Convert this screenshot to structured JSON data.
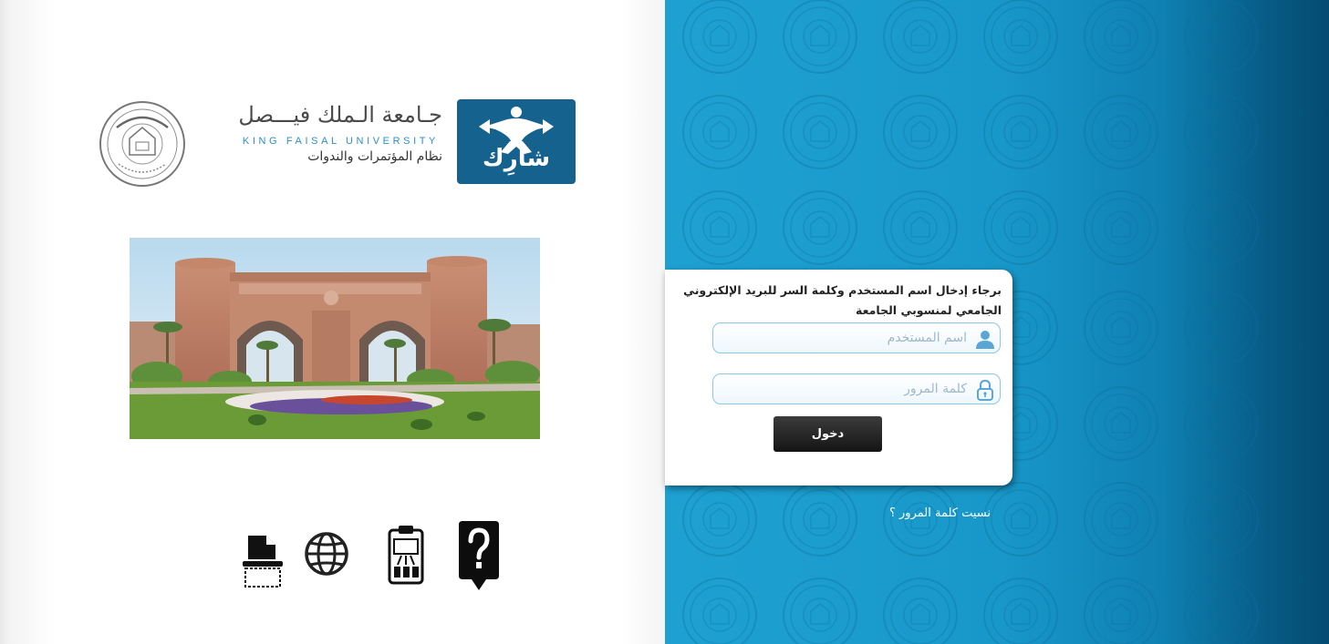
{
  "branding": {
    "share_logo_text": "شارِك",
    "university_name_ar": "جـامعة الـملك فيـــصل",
    "university_name_en": "KING FAISAL UNIVERSITY",
    "system_name": "نظام المؤتمرات والندوات"
  },
  "login": {
    "prompt": "برجاء إدخال اسم المستخدم وكلمة السر للبريد الإلكتروني الجامعي لمنسوبي الجامعة",
    "username_placeholder": "اسم المستخدم",
    "username_value": "",
    "password_placeholder": "كلمة المرور",
    "password_value": "",
    "submit_label": "دخول",
    "forgot_password_label": "نسيت كلمة المرور ؟"
  },
  "bottom_icons": [
    "document-scan-icon",
    "globe-icon",
    "clipboard-chart-icon",
    "help-question-icon"
  ],
  "colors": {
    "brand_blue": "#16628f",
    "panel_blue": "#1ea1d2",
    "button_dark": "#1e1e1e"
  }
}
